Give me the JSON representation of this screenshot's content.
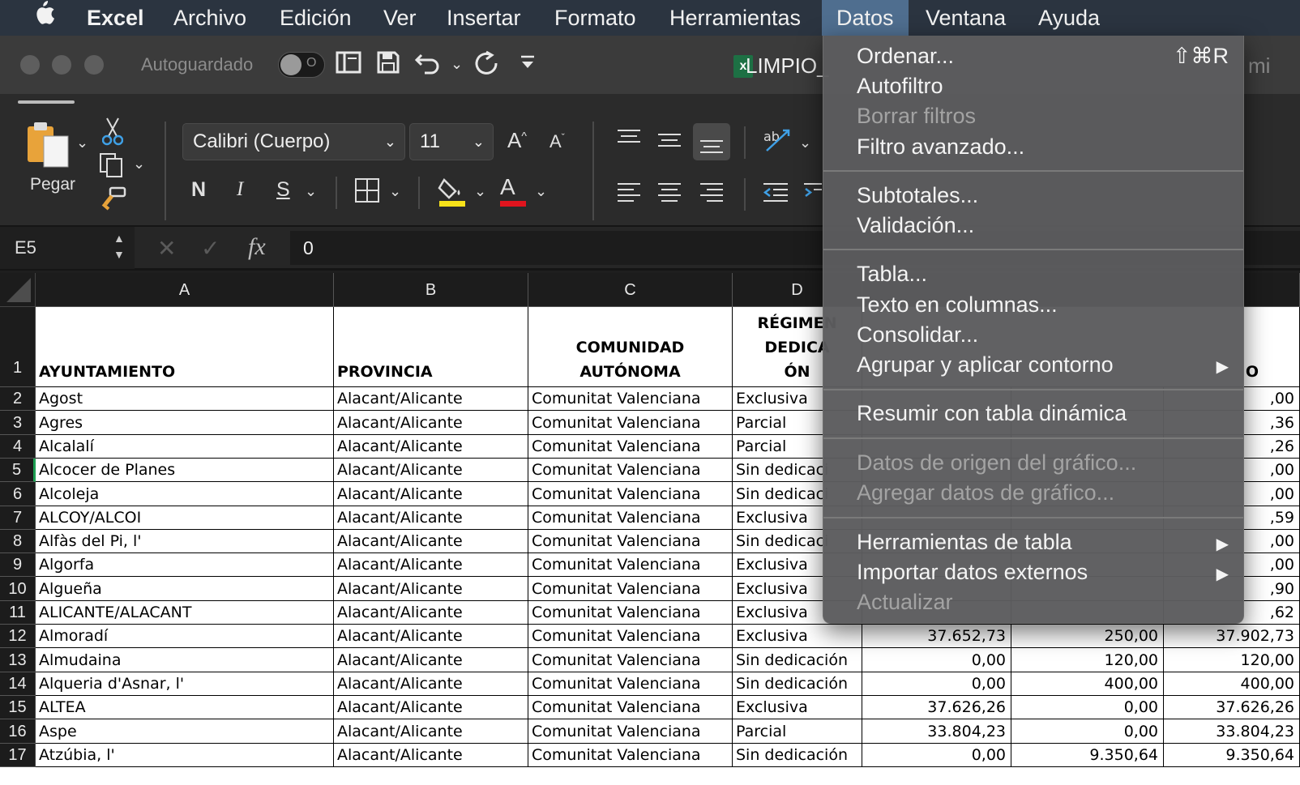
{
  "menubar": {
    "app": "Excel",
    "items": [
      "Archivo",
      "Edición",
      "Ver",
      "Insertar",
      "Formato",
      "Herramientas",
      "Datos",
      "Ventana",
      "Ayuda"
    ],
    "active": "Datos"
  },
  "titlebar": {
    "autosave_label": "Autoguardado",
    "autosave_state": "O",
    "doc_title": "LIMPIO_",
    "right_fragment": "mi",
    "icons": [
      "sidebar-icon",
      "save-icon",
      "undo-icon",
      "redo-icon",
      "customize-icon"
    ]
  },
  "ribbon": {
    "paste_label": "Pegar",
    "font_name": "Calibri (Cuerpo)",
    "font_size": "11",
    "bold": "N",
    "italic": "I",
    "underline": "S",
    "grow_font": "A",
    "shrink_font": "A",
    "font_color_letter": "A",
    "highlight_color": "#f7e21a",
    "font_color": "#e0141e"
  },
  "formula": {
    "name_box": "E5",
    "fx": "fx",
    "value": "0"
  },
  "sheet": {
    "columns": [
      "A",
      "B",
      "C",
      "D"
    ],
    "header_row": {
      "a": "AYUNTAMIENTO",
      "b": "PROVINCIA",
      "c1": "COMUNIDAD",
      "c2": "AUTÓNOMA",
      "d1": "RÉGIMEN",
      "d2": "DEDICA",
      "d3": "ÓN",
      "last": "O"
    },
    "rows": [
      {
        "n": "2",
        "a": "Agost",
        "b": "Alacant/Alicante",
        "c": "Comunitat Valenciana",
        "d": "Exclusiva",
        "e": "",
        "f": "",
        "g": ",00"
      },
      {
        "n": "3",
        "a": "Agres",
        "b": "Alacant/Alicante",
        "c": "Comunitat Valenciana",
        "d": "Parcial",
        "e": "",
        "f": "",
        "g": ",36"
      },
      {
        "n": "4",
        "a": "Alcalalí",
        "b": "Alacant/Alicante",
        "c": "Comunitat Valenciana",
        "d": "Parcial",
        "e": "",
        "f": "",
        "g": ",26"
      },
      {
        "n": "5",
        "a": "Alcocer de Planes",
        "b": "Alacant/Alicante",
        "c": "Comunitat Valenciana",
        "d": "Sin dedicaci",
        "e": "",
        "f": "",
        "g": ",00"
      },
      {
        "n": "6",
        "a": "Alcoleja",
        "b": "Alacant/Alicante",
        "c": "Comunitat Valenciana",
        "d": "Sin dedicaci",
        "e": "",
        "f": "",
        "g": ",00"
      },
      {
        "n": "7",
        "a": "ALCOY/ALCOI",
        "b": "Alacant/Alicante",
        "c": "Comunitat Valenciana",
        "d": "Exclusiva",
        "e": "",
        "f": "",
        "g": ",59"
      },
      {
        "n": "8",
        "a": "Alfàs del Pi, l'",
        "b": "Alacant/Alicante",
        "c": "Comunitat Valenciana",
        "d": "Sin dedicaci",
        "e": "",
        "f": "",
        "g": ",00"
      },
      {
        "n": "9",
        "a": "Algorfa",
        "b": "Alacant/Alicante",
        "c": "Comunitat Valenciana",
        "d": "Exclusiva",
        "e": "",
        "f": "",
        "g": ",00"
      },
      {
        "n": "10",
        "a": "Algueña",
        "b": "Alacant/Alicante",
        "c": "Comunitat Valenciana",
        "d": "Exclusiva",
        "e": "",
        "f": "",
        "g": ",90"
      },
      {
        "n": "11",
        "a": "ALICANTE/ALACANT",
        "b": "Alacant/Alicante",
        "c": "Comunitat Valenciana",
        "d": "Exclusiva",
        "e": "",
        "f": "",
        "g": ",62"
      },
      {
        "n": "12",
        "a": "Almoradí",
        "b": "Alacant/Alicante",
        "c": "Comunitat Valenciana",
        "d": "Exclusiva",
        "e": "37.652,73",
        "f": "250,00",
        "g": "37.902,73"
      },
      {
        "n": "13",
        "a": "Almudaina",
        "b": "Alacant/Alicante",
        "c": "Comunitat Valenciana",
        "d": "Sin dedicación",
        "e": "0,00",
        "f": "120,00",
        "g": "120,00"
      },
      {
        "n": "14",
        "a": "Alqueria d'Asnar, l'",
        "b": "Alacant/Alicante",
        "c": "Comunitat Valenciana",
        "d": "Sin dedicación",
        "e": "0,00",
        "f": "400,00",
        "g": "400,00"
      },
      {
        "n": "15",
        "a": "ALTEA",
        "b": "Alacant/Alicante",
        "c": "Comunitat Valenciana",
        "d": "Exclusiva",
        "e": "37.626,26",
        "f": "0,00",
        "g": "37.626,26"
      },
      {
        "n": "16",
        "a": "Aspe",
        "b": "Alacant/Alicante",
        "c": "Comunitat Valenciana",
        "d": "Parcial",
        "e": "33.804,23",
        "f": "0,00",
        "g": "33.804,23"
      },
      {
        "n": "17",
        "a": "Atzúbia, l'",
        "b": "Alacant/Alicante",
        "c": "Comunitat Valenciana",
        "d": "Sin dedicación",
        "e": "0,00",
        "f": "9.350,64",
        "g": "9.350,64"
      }
    ]
  },
  "datos_menu": {
    "shortcut_ordenar": "⇧⌘R",
    "items": [
      {
        "label": "Ordenar...",
        "disabled": false
      },
      {
        "label": "Autofiltro",
        "disabled": false
      },
      {
        "label": "Borrar filtros",
        "disabled": true
      },
      {
        "label": "Filtro avanzado...",
        "disabled": false
      },
      {
        "label": "Subtotales...",
        "disabled": false
      },
      {
        "label": "Validación...",
        "disabled": false
      },
      {
        "label": "Tabla...",
        "disabled": false
      },
      {
        "label": "Texto en columnas...",
        "disabled": false
      },
      {
        "label": "Consolidar...",
        "disabled": false
      },
      {
        "label": "Agrupar y aplicar contorno",
        "disabled": false,
        "submenu": true
      },
      {
        "label": "Resumir con tabla dinámica",
        "disabled": false
      },
      {
        "label": "Datos de origen del gráfico...",
        "disabled": true
      },
      {
        "label": "Agregar datos de gráfico...",
        "disabled": true
      },
      {
        "label": "Herramientas de tabla",
        "disabled": false,
        "submenu": true
      },
      {
        "label": "Importar datos externos",
        "disabled": false,
        "submenu": true
      },
      {
        "label": "Actualizar",
        "disabled": true
      }
    ]
  }
}
